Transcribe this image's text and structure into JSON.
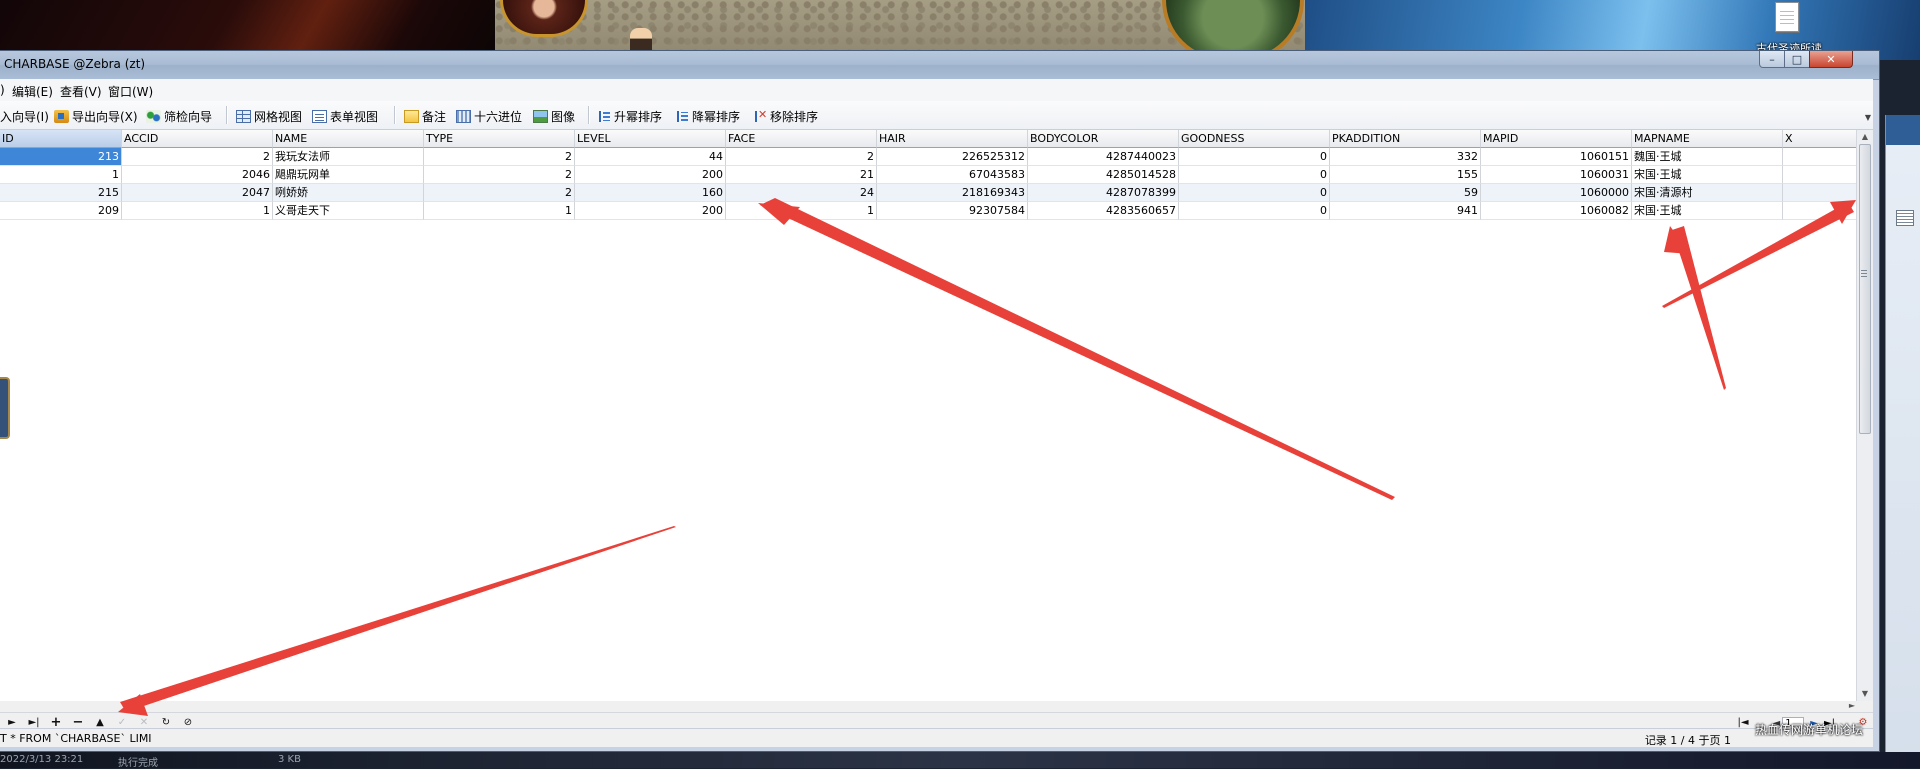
{
  "desktop": {
    "file_icon_label": "古代圣迹所读"
  },
  "window": {
    "title": "CHARBASE @Zebra (zt)",
    "buttons": {
      "minimize": "–",
      "maximize": "□",
      "close": "✕"
    }
  },
  "menu": {
    "items": [
      "编辑(E)",
      "查看(V)",
      "窗口(W)"
    ],
    "partial_first": ")"
  },
  "toolbar": {
    "import": "入向导(I)",
    "export": "导出向导(X)",
    "filter": "筛检向导",
    "grid_view": "网格视图",
    "form_view": "表单视图",
    "memo": "备注",
    "hex": "十六进位",
    "image": "图像",
    "sort_asc": "升幂排序",
    "sort_desc": "降幂排序",
    "remove_sort": "移除排序"
  },
  "grid": {
    "columns": [
      "ID",
      "ACCID",
      "NAME",
      "TYPE",
      "LEVEL",
      "FACE",
      "HAIR",
      "BODYCOLOR",
      "GOODNESS",
      "PKADDITION",
      "MAPID",
      "MAPNAME",
      "X"
    ],
    "rows": [
      [
        "213",
        "2",
        "我玩女法师",
        "2",
        "44",
        "2",
        "226525312",
        "4287440023",
        "0",
        "332",
        "1060151",
        "魏国·王城",
        ""
      ],
      [
        "1",
        "2046",
        "飓鼎玩网单",
        "2",
        "200",
        "21",
        "67043583",
        "4285014528",
        "0",
        "155",
        "1060031",
        "宋国·王城",
        ""
      ],
      [
        "215",
        "2047",
        "咧娇娇",
        "2",
        "160",
        "24",
        "218169343",
        "4287078399",
        "0",
        "59",
        "1060000",
        "宋国·清源村",
        ""
      ],
      [
        "209",
        "1",
        "义哥走天下",
        "1",
        "200",
        "1",
        "92307584",
        "4283560657",
        "0",
        "941",
        "1060082",
        "宋国·王城",
        ""
      ]
    ]
  },
  "navbar": {
    "page_value": "1",
    "icons": [
      "next-record",
      "last-record",
      "add-record",
      "delete-record",
      "up",
      "apply-changes",
      "cancel-changes",
      "refresh",
      "stop"
    ]
  },
  "status": {
    "sql": "T * FROM `CHARBASE` LIMI",
    "record": "记录 1 / 4 于页 1",
    "watermark": "热血传网游单机论坛"
  },
  "bottom_strip": {
    "date": "2022/3/13 23:21",
    "status": "执行完成",
    "size": "3 KB"
  },
  "colors": {
    "selection": "#3d86d8",
    "annotation_arrow": "#e8413a",
    "window_frame": "#aabdd6"
  }
}
